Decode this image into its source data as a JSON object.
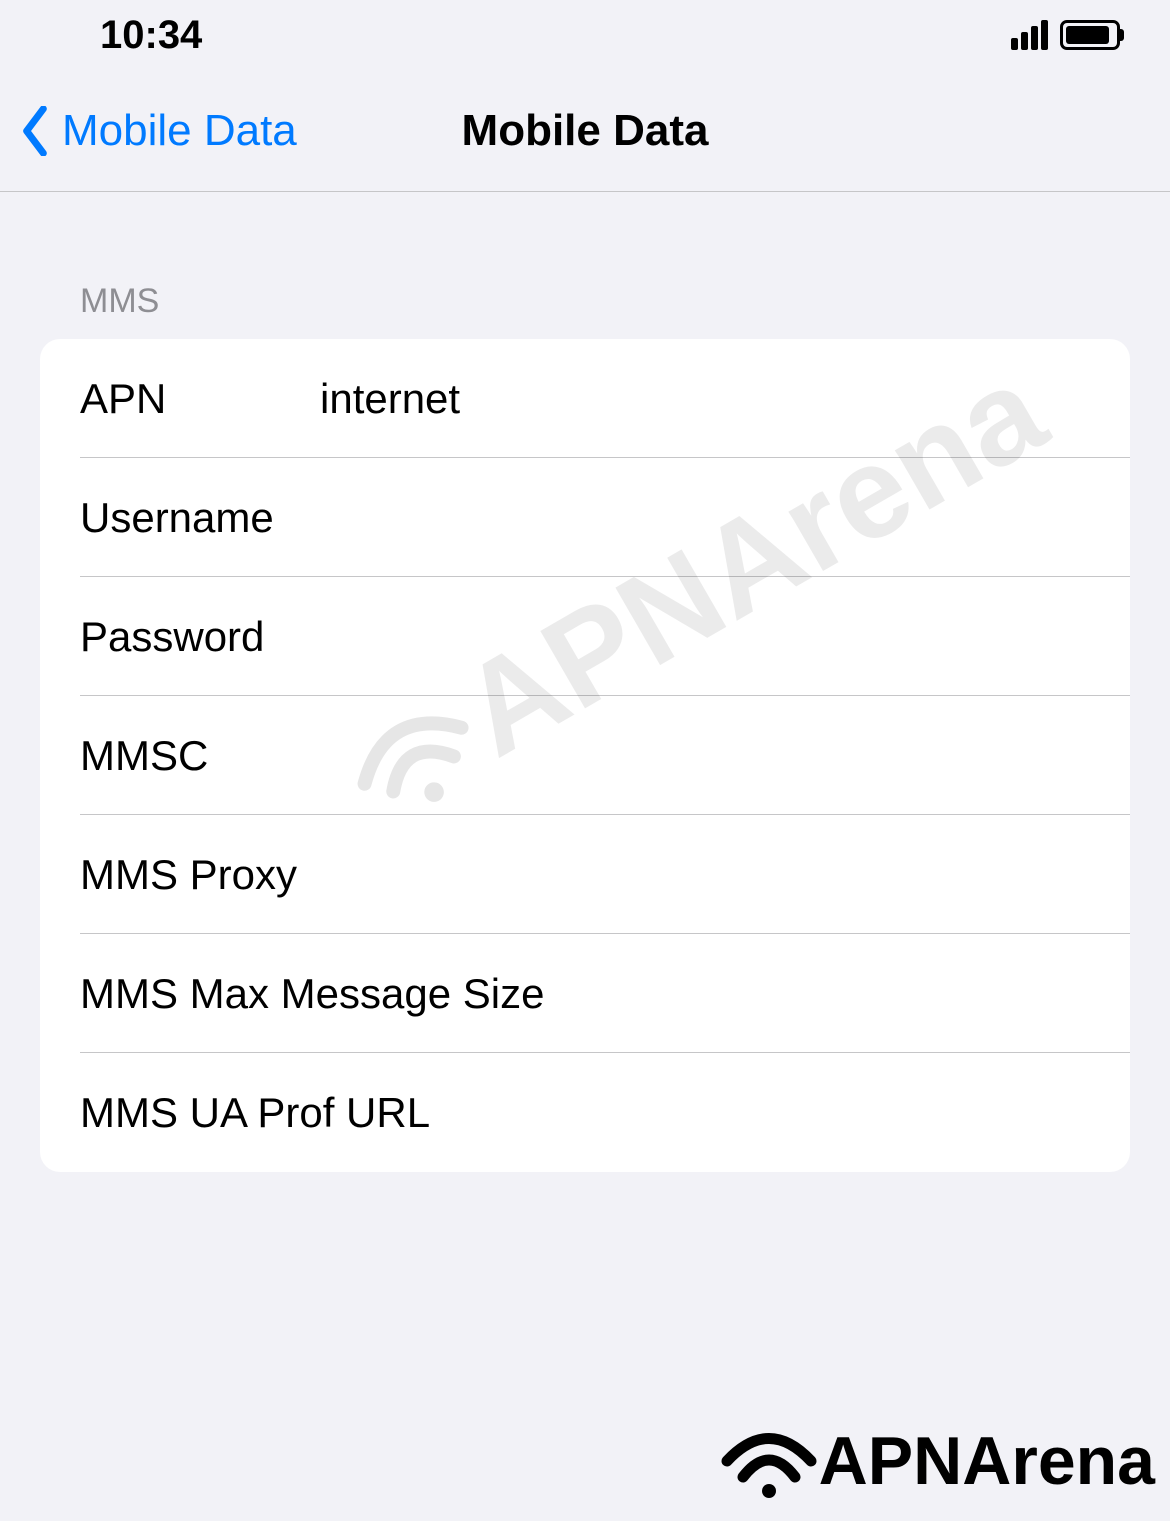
{
  "statusBar": {
    "time": "10:34"
  },
  "nav": {
    "backLabel": "Mobile Data",
    "title": "Mobile Data"
  },
  "section": {
    "header": "MMS"
  },
  "rows": {
    "apn": {
      "label": "APN",
      "value": "internet"
    },
    "username": {
      "label": "Username",
      "value": ""
    },
    "password": {
      "label": "Password",
      "value": ""
    },
    "mmsc": {
      "label": "MMSC",
      "value": ""
    },
    "mmsProxy": {
      "label": "MMS Proxy",
      "value": ""
    },
    "mmsMaxSize": {
      "label": "MMS Max Message Size",
      "value": ""
    },
    "mmsUaProf": {
      "label": "MMS UA Prof URL",
      "value": ""
    }
  },
  "watermark": {
    "text": "APNArena"
  },
  "footer": {
    "text": "APNArena"
  }
}
